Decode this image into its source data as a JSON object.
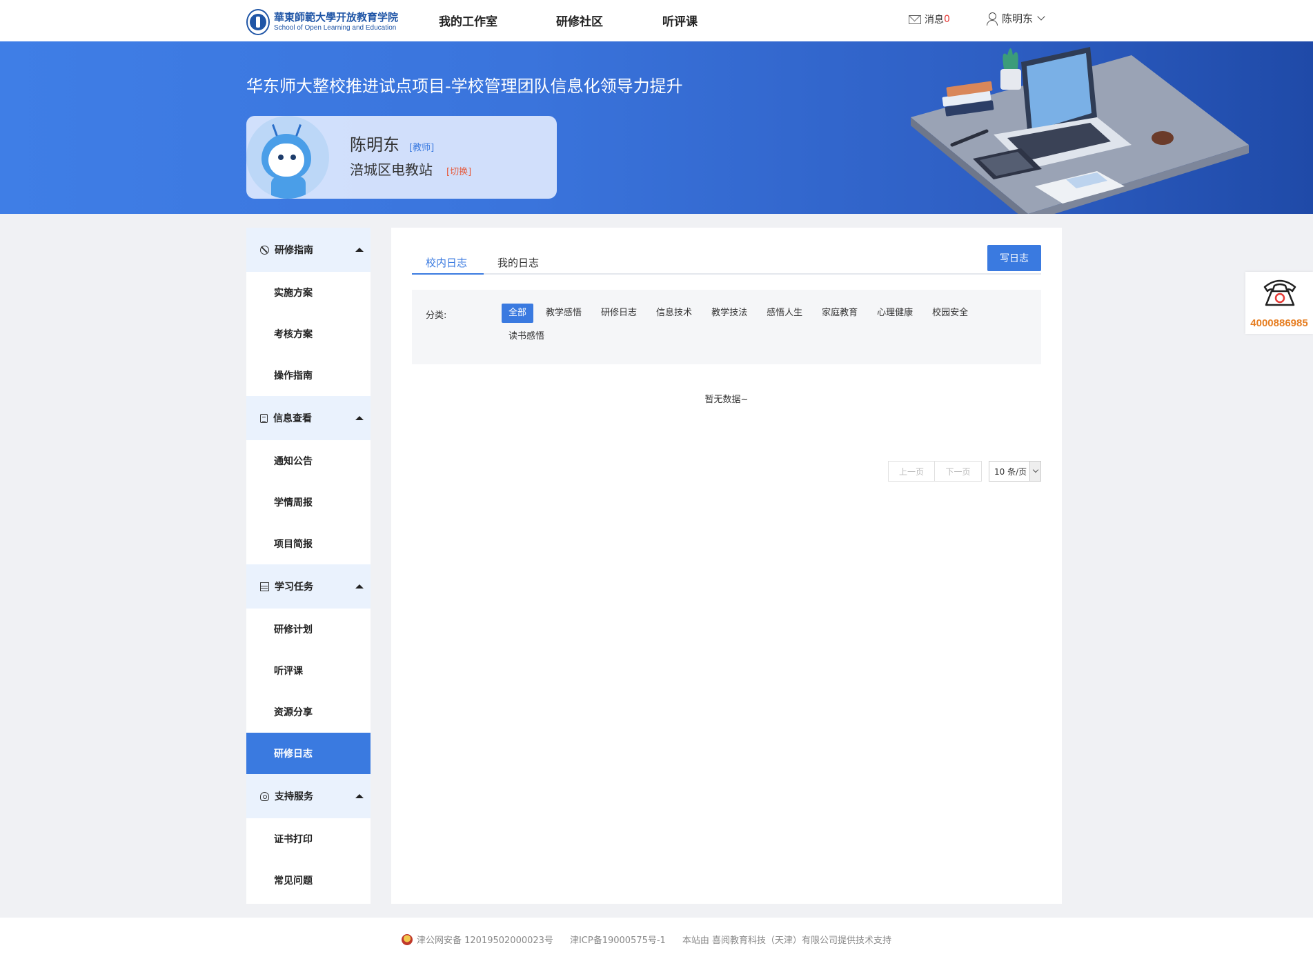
{
  "header": {
    "logo_cn": "華東師範大學开放教育学院",
    "logo_en": "School of Open Learning and Education",
    "nav": [
      "我的工作室",
      "研修社区",
      "听评课"
    ],
    "messages_label": "消息",
    "messages_count": "0",
    "user_name": "陈明东"
  },
  "banner": {
    "title": "华东师大整校推进试点项目-学校管理团队信息化领导力提升",
    "name": "陈明东",
    "role": "[教师]",
    "org": "涪城区电教站",
    "switch": "[切换]"
  },
  "sidebar": {
    "groups": [
      {
        "label": "研修指南",
        "icon": "guide-icon",
        "items": [
          "实施方案",
          "考核方案",
          "操作指南"
        ]
      },
      {
        "label": "信息查看",
        "icon": "document-icon",
        "items": [
          "通知公告",
          "学情周报",
          "项目简报"
        ]
      },
      {
        "label": "学习任务",
        "icon": "task-icon",
        "items": [
          "研修计划",
          "听评课",
          "资源分享",
          "研修日志"
        ]
      },
      {
        "label": "支持服务",
        "icon": "support-icon",
        "items": [
          "证书打印",
          "常见问题"
        ]
      }
    ],
    "active_item": "研修日志"
  },
  "main": {
    "tabs": [
      "校内日志",
      "我的日志"
    ],
    "active_tab": "校内日志",
    "write_button": "写日志",
    "filter_label": "分类:",
    "filter_options": [
      "全部",
      "教学感悟",
      "研修日志",
      "信息技术",
      "教学技法",
      "感悟人生",
      "家庭教育",
      "心理健康",
      "校园安全",
      "读书感悟"
    ],
    "selected_filter": "全部",
    "empty_text": "暂无数据~",
    "pager": {
      "prev": "上一页",
      "next": "下一页",
      "page_size": "10 条/页"
    }
  },
  "phone": {
    "number": "4000886985"
  },
  "footer": {
    "police": "津公网安备 12019502000023号",
    "icp": "津ICP备19000575号-1",
    "support": "本站由 喜阅教育科技（天津）有限公司提供技术支持"
  },
  "colors": {
    "primary": "#3a7ae0",
    "accent_red": "#e53935",
    "phone_orange": "#e67e22"
  }
}
